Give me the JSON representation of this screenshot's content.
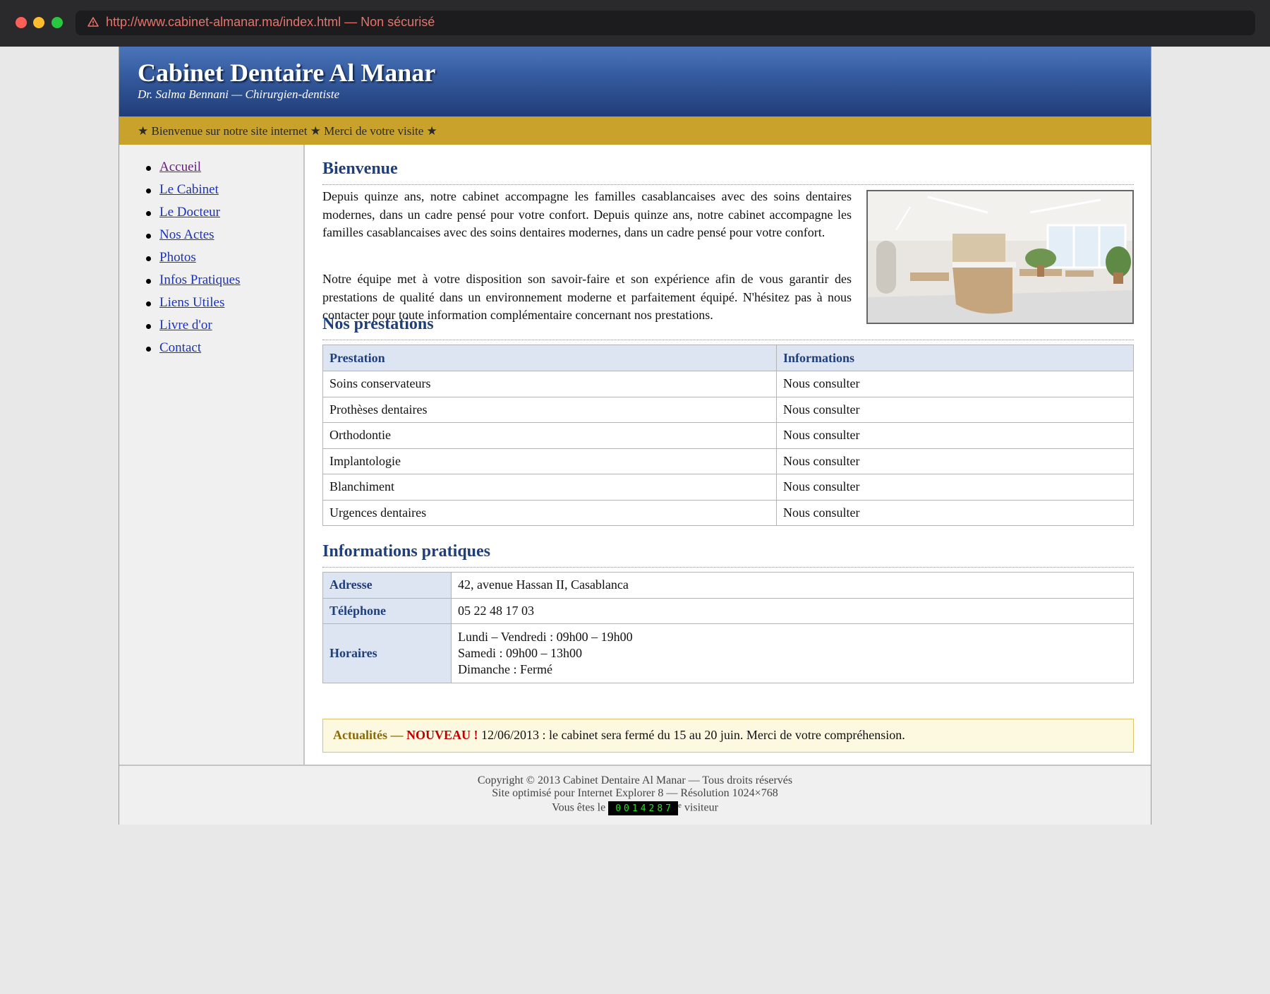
{
  "browser": {
    "url": "http://www.cabinet-almanar.ma/index.html — Non sécurisé"
  },
  "header": {
    "title": "Cabinet Dentaire Al Manar",
    "subtitle": "Dr. Salma Bennani — Chirurgien-dentiste"
  },
  "marquee": "★ Bienvenue sur notre site internet ★ Merci de votre visite ★",
  "nav": [
    {
      "label": "Accueil",
      "visited": true
    },
    {
      "label": "Le Cabinet"
    },
    {
      "label": "Le Docteur"
    },
    {
      "label": "Nos Actes"
    },
    {
      "label": "Photos"
    },
    {
      "label": "Infos Pratiques"
    },
    {
      "label": "Liens Utiles"
    },
    {
      "label": "Livre d'or"
    },
    {
      "label": "Contact"
    }
  ],
  "welcome": {
    "heading": "Bienvenue",
    "paragraph1": "Depuis quinze ans, notre cabinet accompagne les familles casablancaises avec des soins dentaires modernes, dans un cadre pensé pour votre confort. Depuis quinze ans, notre cabinet accompagne les familles casablancaises avec des soins dentaires modernes, dans un cadre pensé pour votre confort.",
    "paragraph2": "Notre équipe met à votre disposition son savoir-faire et son expérience afin de vous garantir des prestations de qualité dans un environnement moderne et parfaitement équipé. N'hésitez pas à nous contacter pour toute information complémentaire concernant nos prestations."
  },
  "services": {
    "heading": "Nos prestations",
    "columns": [
      "Prestation",
      "Informations"
    ],
    "rows": [
      [
        "Soins conservateurs",
        "Nous consulter"
      ],
      [
        "Prothèses dentaires",
        "Nous consulter"
      ],
      [
        "Orthodontie",
        "Nous consulter"
      ],
      [
        "Implantologie",
        "Nous consulter"
      ],
      [
        "Blanchiment",
        "Nous consulter"
      ],
      [
        "Urgences dentaires",
        "Nous consulter"
      ]
    ]
  },
  "practical": {
    "heading": "Informations pratiques",
    "address_label": "Adresse",
    "address": "42, avenue Hassan II, Casablanca",
    "phone_label": "Téléphone",
    "phone": "05 22 48 17 03",
    "hours_label": "Horaires",
    "hours": [
      "Lundi – Vendredi : 09h00 – 19h00",
      "Samedi : 09h00 – 13h00",
      "Dimanche : Fermé"
    ]
  },
  "news": {
    "label": "Actualités — ",
    "new_tag": "NOUVEAU !",
    "text": " 12/06/2013 : le cabinet sera fermé du 15 au 20 juin. Merci de votre compréhension."
  },
  "footer": {
    "copyright": "Copyright © 2013 Cabinet Dentaire Al Manar — Tous droits réservés",
    "optimized": "Site optimisé pour Internet Explorer 8 — Résolution 1024×768",
    "visitor_prefix": "Vous êtes le ",
    "counter": "0014287",
    "visitor_sup": "e",
    "visitor_suffix": " visiteur"
  },
  "colors": {
    "header_blue": "#34599c",
    "marquee_gold": "#c8a22a",
    "heading_blue": "#1f3f7a",
    "link_blue": "#1a33b8",
    "visited_purple": "#6a1b8a",
    "new_red": "#c00000",
    "counter_green": "#23e023"
  },
  "icons": {
    "url_warning": "warning-triangle-icon"
  }
}
